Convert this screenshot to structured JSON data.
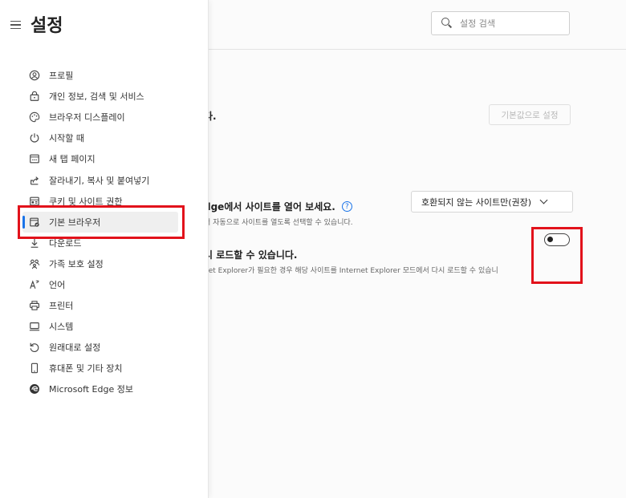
{
  "sidebar": {
    "title": "설정",
    "items": [
      {
        "label": "프로필",
        "icon": "profile-icon"
      },
      {
        "label": "개인 정보, 검색 및 서비스",
        "icon": "lock-icon"
      },
      {
        "label": "브라우저 디스플레이",
        "icon": "palette-icon"
      },
      {
        "label": "시작할 때",
        "icon": "power-icon"
      },
      {
        "label": "새 탭 페이지",
        "icon": "new-tab-icon"
      },
      {
        "label": "잘라내기, 복사 및 붙여넣기",
        "icon": "share-icon"
      },
      {
        "label": "쿠키 및 사이트 권한",
        "icon": "cookie-icon"
      },
      {
        "label": "기본 브라우저",
        "icon": "default-browser-icon",
        "selected": true
      },
      {
        "label": "다운로드",
        "icon": "download-icon"
      },
      {
        "label": "가족 보호 설정",
        "icon": "family-icon"
      },
      {
        "label": "언어",
        "icon": "language-icon"
      },
      {
        "label": "프린터",
        "icon": "printer-icon"
      },
      {
        "label": "시스템",
        "icon": "system-icon"
      },
      {
        "label": "원래대로 설정",
        "icon": "reset-icon"
      },
      {
        "label": "휴대폰 및 기타 장치",
        "icon": "phone-icon"
      },
      {
        "label": "Microsoft Edge 정보",
        "icon": "edge-icon"
      }
    ]
  },
  "search": {
    "placeholder": "설정 검색"
  },
  "main": {
    "default_text": "다.",
    "reset_button": "기본값으로 설정",
    "open_title": "dge에서 사이트를 열어 보세요.",
    "open_help": "?",
    "open_desc": "서 자동으로 사이트를 열도록 선택할 수 있습니다.",
    "dropdown_value": "호환되지 않는 사이트만(권장)",
    "reload_title": "시 로드할 수 있습니다.",
    "reload_desc": "net Explorer가 필요한 경우 해당 사이트를 Internet Explorer 모드에서 다시 로드할 수 있습니",
    "toggle_on": false
  },
  "colors": {
    "accent": "#1a73e8",
    "annotation": "#e2121b"
  }
}
